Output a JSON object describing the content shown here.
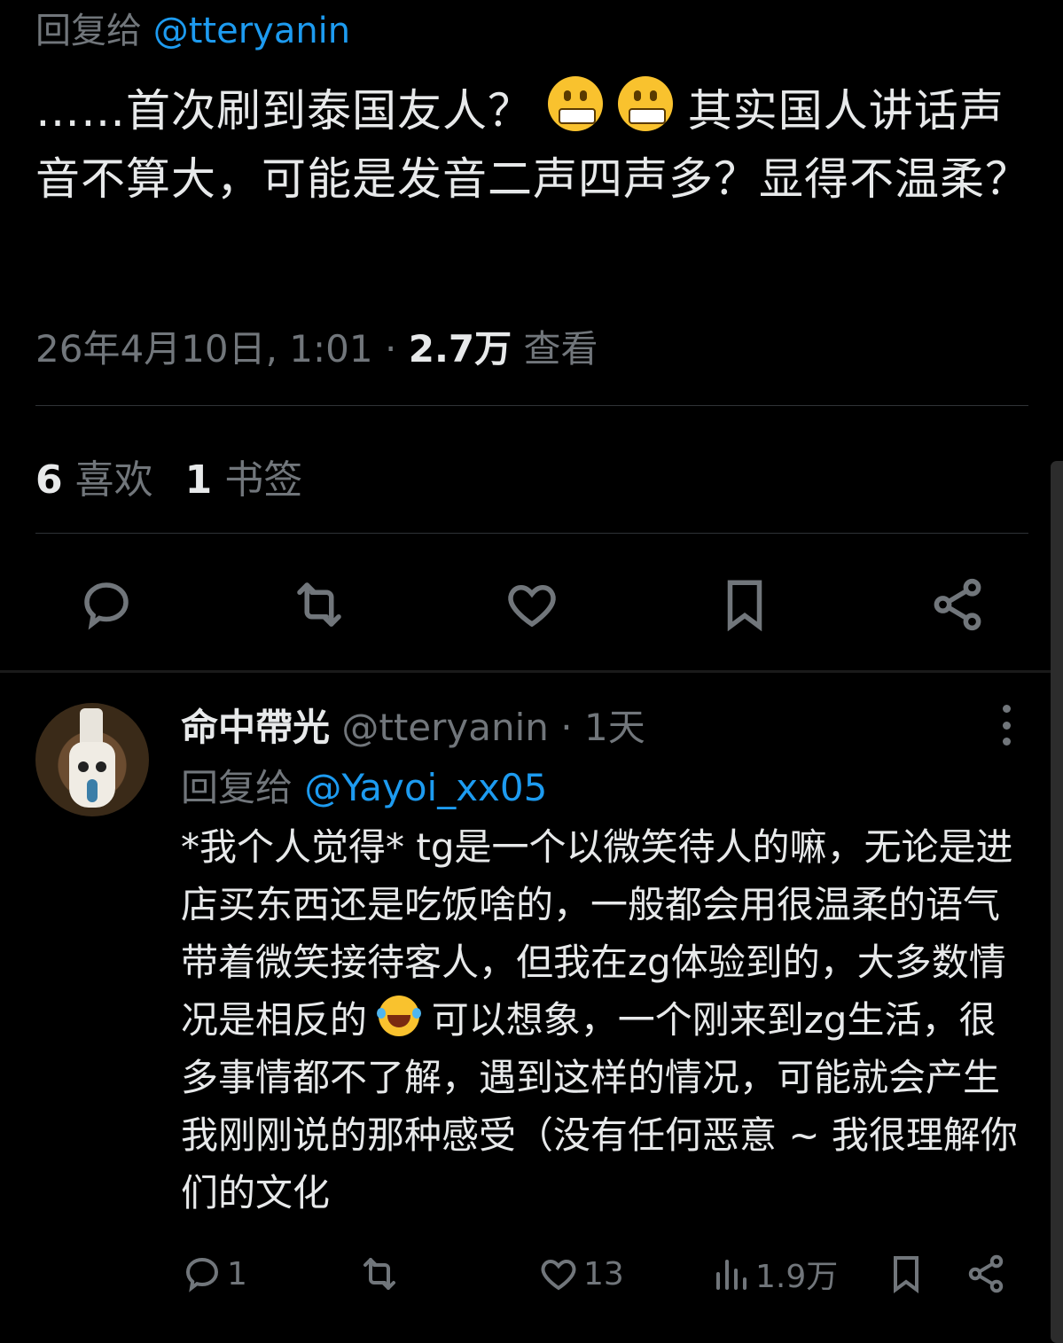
{
  "main_tweet": {
    "reply_prefix": "回复给",
    "reply_handle": "@tteryanin",
    "text_before_emoji": "……首次刷到泰国友人？",
    "emoji": "grimacing-face-emoji",
    "text_after_emoji": "其实国人讲话声音不算大，可能是发音二声四声多？显得不温柔？",
    "timestamp": "26年4月10日, 1:01",
    "separator": "·",
    "views_count": "2.7万",
    "views_label": "查看",
    "likes_count": "6",
    "likes_label": "喜欢",
    "bookmarks_count": "1",
    "bookmarks_label": "书签",
    "actions": [
      "reply-icon",
      "retweet-icon",
      "like-icon",
      "bookmark-icon",
      "share-icon"
    ]
  },
  "reply": {
    "display_name": "命中帶光",
    "handle": "@tteryanin",
    "separator": "·",
    "time_ago": "1天",
    "reply_prefix": "回复给",
    "reply_handle": "@Yayoi_xx05",
    "text_part1": "*我个人觉得* tg是一个以微笑待人的嘛，无论是进店买东西还是吃饭啥的，一般都会用很温柔的语气带着微笑接待客人，但我在zg体验到的，大多数情况是相反的",
    "text_part2": " 可以想象，一个刚来到zg生活，很多事情都不了解，遇到这样的情况，可能就会产生我刚刚说的那种感受（没有任何恶意 ~ 我很理解你们的文化",
    "reply_count": "1",
    "retweet_count": "",
    "like_count": "13",
    "view_count": "1.9万",
    "colors": {
      "background": "#000000",
      "text": "#e7e9ea",
      "muted": "#71767b",
      "link": "#1d9bf0"
    }
  }
}
